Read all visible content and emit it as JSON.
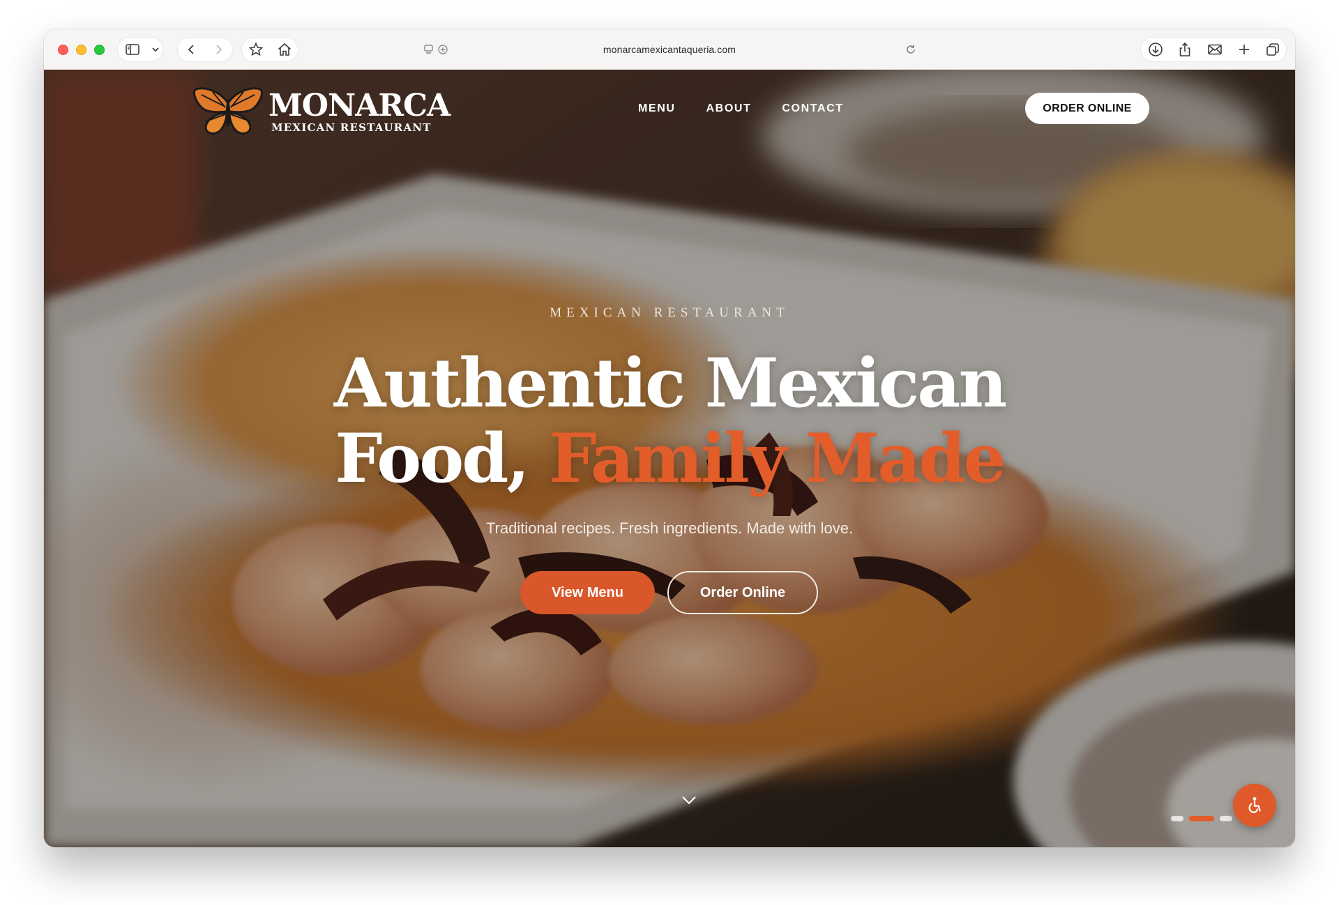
{
  "browser": {
    "url": "monarcamexicantaqueria.com"
  },
  "header": {
    "logo_name": "MONARCA",
    "logo_subtitle": "MEXICAN RESTAURANT",
    "nav": [
      "MENU",
      "ABOUT",
      "CONTACT"
    ],
    "order_button": "ORDER ONLINE"
  },
  "hero": {
    "eyebrow": "MEXICAN RESTAURANT",
    "headline_line1": "Authentic Mexican",
    "headline_line2_start": "Food,",
    "headline_accent": "Family Made",
    "subline": "Traditional recipes. Fresh ingredients. Made with love.",
    "primary_button": "View Menu",
    "secondary_button": "Order Online",
    "slide_count": 3,
    "active_slide": 2
  },
  "colors": {
    "accent": "#e35d2a",
    "button": "#d9572a"
  },
  "icons": [
    "sidebar-icon",
    "chevron-down-icon",
    "back-icon",
    "forward-icon",
    "star-icon",
    "home-icon",
    "reader-icon",
    "reload-icon",
    "download-icon",
    "share-icon",
    "mail-icon",
    "new-tab-icon",
    "tabs-icon",
    "butterfly-logo-icon",
    "scroll-down-icon",
    "accessibility-icon"
  ]
}
